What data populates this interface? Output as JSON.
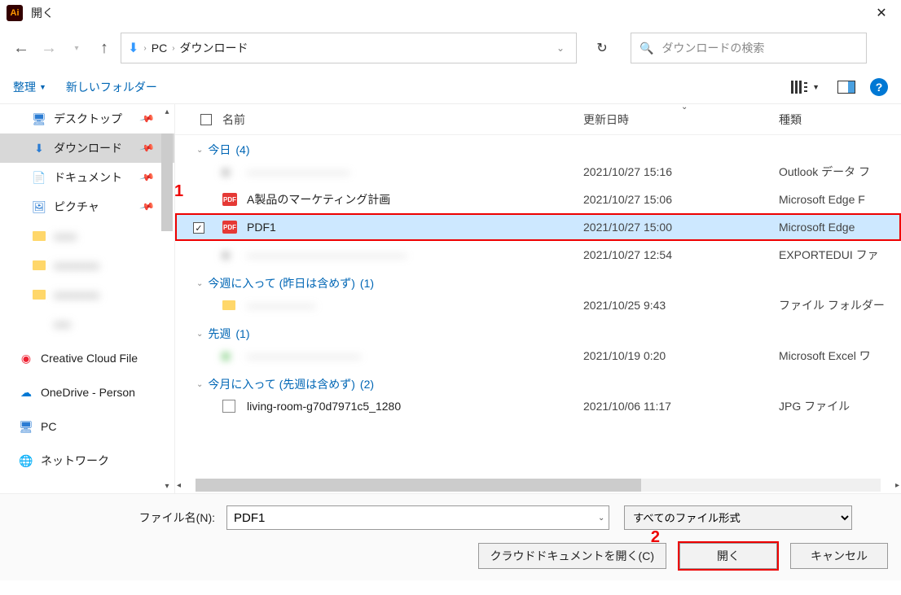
{
  "title": "開く",
  "breadcrumb": {
    "root": "PC",
    "current": "ダウンロード"
  },
  "search": {
    "placeholder": "ダウンロードの検索"
  },
  "toolbar": {
    "organize": "整理",
    "newfolder": "新しいフォルダー"
  },
  "sidebar": {
    "desktop": "デスクトップ",
    "downloads": "ダウンロード",
    "documents": "ドキュメント",
    "pictures": "ピクチャ",
    "ccf": "Creative Cloud File",
    "onedrive": "OneDrive - Person",
    "pc": "PC",
    "network": "ネットワーク"
  },
  "columns": {
    "name": "名前",
    "date": "更新日時",
    "type": "種類"
  },
  "groups": {
    "today": {
      "label": "今日",
      "count": "(4)"
    },
    "thisweek": {
      "label": "今週に入って (昨日は含めず)",
      "count": "(1)"
    },
    "lastweek": {
      "label": "先週",
      "count": "(1)"
    },
    "thismonth": {
      "label": "今月に入って (先週は含めず)",
      "count": "(2)"
    }
  },
  "files": {
    "r1": {
      "name": "―――――――――",
      "date": "2021/10/27 15:16",
      "type": "Outlook データ フ"
    },
    "r2": {
      "name": "A製品のマーケティング計画",
      "date": "2021/10/27 15:06",
      "type": "Microsoft Edge F"
    },
    "r3": {
      "name": "PDF1",
      "date": "2021/10/27 15:00",
      "type": "Microsoft Edge "
    },
    "r4": {
      "name": "――――――――――――――",
      "date": "2021/10/27 12:54",
      "type": "EXPORTEDUI ファ"
    },
    "w1": {
      "name": "――――――",
      "date": "2021/10/25 9:43",
      "type": "ファイル フォルダー"
    },
    "l1": {
      "name": "――――――――――",
      "date": "2021/10/19 0:20",
      "type": "Microsoft Excel ワ"
    },
    "m1": {
      "name": "living-room-g70d7971c5_1280",
      "date": "2021/10/06 11:17",
      "type": "JPG ファイル"
    }
  },
  "footer": {
    "filename_label": "ファイル名(N):",
    "filename_value": "PDF1",
    "filter": "すべてのファイル形式",
    "cloud": "クラウドドキュメントを開く(C)",
    "open": "開く",
    "cancel": "キャンセル"
  },
  "annotations": {
    "a1": "1",
    "a2": "2"
  }
}
